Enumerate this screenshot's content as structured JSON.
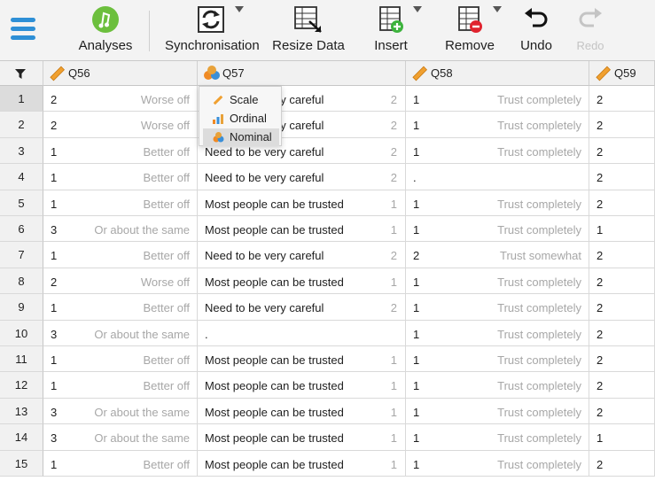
{
  "toolbar": {
    "analyses": "Analyses",
    "synchronisation": "Synchronisation",
    "resize_data": "Resize Data",
    "insert": "Insert",
    "remove": "Remove",
    "undo": "Undo",
    "redo": "Redo"
  },
  "columns": [
    "Q56",
    "Q57",
    "Q58",
    "Q59"
  ],
  "measure_menu": {
    "items": [
      "Scale",
      "Ordinal",
      "Nominal"
    ],
    "selected": "Nominal"
  },
  "rows": [
    {
      "n": "1",
      "q56": "2",
      "q56_label": "Worse off",
      "q57_label": "Need to be very careful",
      "q57_val": "2",
      "q58": "1",
      "q58_label": "Trust completely",
      "q59": "2"
    },
    {
      "n": "2",
      "q56": "2",
      "q56_label": "Worse off",
      "q57_label": "Need to be very careful",
      "q57_val": "2",
      "q58": "1",
      "q58_label": "Trust completely",
      "q59": "2"
    },
    {
      "n": "3",
      "q56": "1",
      "q56_label": "Better off",
      "q57_label": "Need to be very careful",
      "q57_val": "2",
      "q58": "1",
      "q58_label": "Trust completely",
      "q59": "2"
    },
    {
      "n": "4",
      "q56": "1",
      "q56_label": "Better off",
      "q57_label": "Need to be very careful",
      "q57_val": "2",
      "q58": ".",
      "q58_label": "",
      "q59": "2"
    },
    {
      "n": "5",
      "q56": "1",
      "q56_label": "Better off",
      "q57_label": "Most people can be trusted",
      "q57_val": "1",
      "q58": "1",
      "q58_label": "Trust completely",
      "q59": "2"
    },
    {
      "n": "6",
      "q56": "3",
      "q56_label": "Or about the same",
      "q57_label": "Most people can be trusted",
      "q57_val": "1",
      "q58": "1",
      "q58_label": "Trust completely",
      "q59": "1"
    },
    {
      "n": "7",
      "q56": "1",
      "q56_label": "Better off",
      "q57_label": "Need to be very careful",
      "q57_val": "2",
      "q58": "2",
      "q58_label": "Trust somewhat",
      "q59": "2"
    },
    {
      "n": "8",
      "q56": "2",
      "q56_label": "Worse off",
      "q57_label": "Most people can be trusted",
      "q57_val": "1",
      "q58": "1",
      "q58_label": "Trust completely",
      "q59": "2"
    },
    {
      "n": "9",
      "q56": "1",
      "q56_label": "Better off",
      "q57_label": "Need to be very careful",
      "q57_val": "2",
      "q58": "1",
      "q58_label": "Trust completely",
      "q59": "2"
    },
    {
      "n": "10",
      "q56": "3",
      "q56_label": "Or about the same",
      "q57_label": ".",
      "q57_val": "",
      "q58": "1",
      "q58_label": "Trust completely",
      "q59": "2"
    },
    {
      "n": "11",
      "q56": "1",
      "q56_label": "Better off",
      "q57_label": "Most people can be trusted",
      "q57_val": "1",
      "q58": "1",
      "q58_label": "Trust completely",
      "q59": "2"
    },
    {
      "n": "12",
      "q56": "1",
      "q56_label": "Better off",
      "q57_label": "Most people can be trusted",
      "q57_val": "1",
      "q58": "1",
      "q58_label": "Trust completely",
      "q59": "2"
    },
    {
      "n": "13",
      "q56": "3",
      "q56_label": "Or about the same",
      "q57_label": "Most people can be trusted",
      "q57_val": "1",
      "q58": "1",
      "q58_label": "Trust completely",
      "q59": "2"
    },
    {
      "n": "14",
      "q56": "3",
      "q56_label": "Or about the same",
      "q57_label": "Most people can be trusted",
      "q57_val": "1",
      "q58": "1",
      "q58_label": "Trust completely",
      "q59": "1"
    },
    {
      "n": "15",
      "q56": "1",
      "q56_label": "Better off",
      "q57_label": "Most people can be trusted",
      "q57_val": "1",
      "q58": "1",
      "q58_label": "Trust completely",
      "q59": "2"
    }
  ]
}
